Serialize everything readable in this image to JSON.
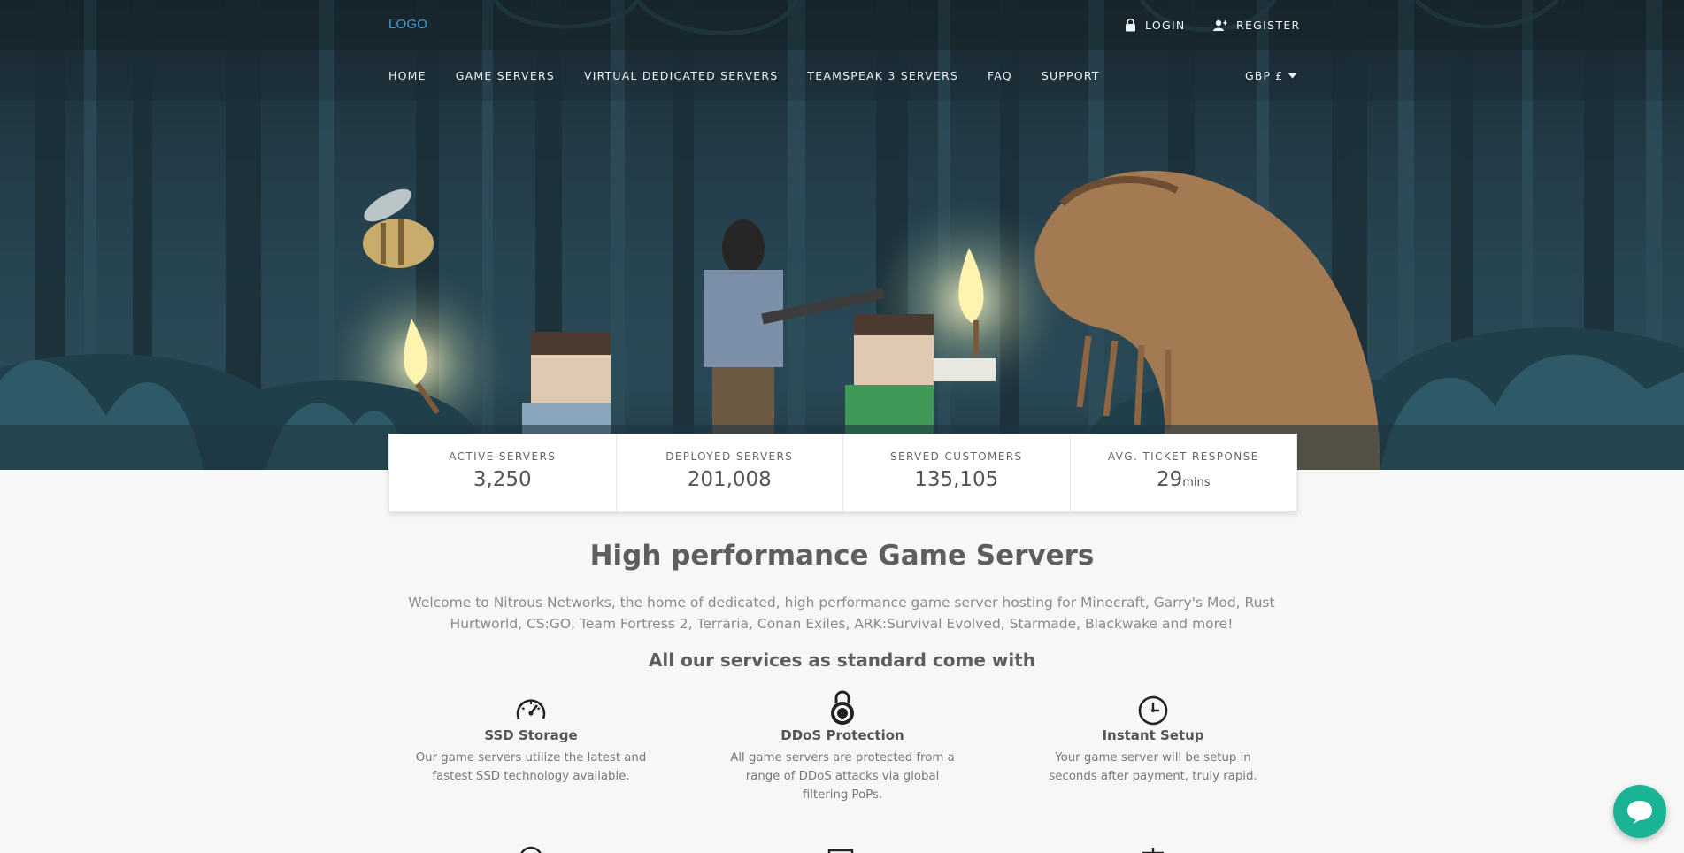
{
  "header": {
    "logo": "LOGO",
    "login": "LOGIN",
    "register": "REGISTER",
    "currency": "GBP £"
  },
  "nav": {
    "items": [
      {
        "label": "HOME"
      },
      {
        "label": "GAME SERVERS"
      },
      {
        "label": "VIRTUAL DEDICATED SERVERS"
      },
      {
        "label": "TEAMSPEAK 3 SERVERS"
      },
      {
        "label": "FAQ"
      },
      {
        "label": "SUPPORT"
      }
    ]
  },
  "stats": [
    {
      "label": "ACTIVE SERVERS",
      "value": "3,250",
      "unit": ""
    },
    {
      "label": "DEPLOYED SERVERS",
      "value": "201,008",
      "unit": ""
    },
    {
      "label": "SERVED CUSTOMERS",
      "value": "135,105",
      "unit": ""
    },
    {
      "label": "AVG. TICKET RESPONSE",
      "value": "29",
      "unit": "mins"
    }
  ],
  "main": {
    "headline": "High performance Game Servers",
    "intro": "Welcome to Nitrous Networks, the home of dedicated, high performance game server hosting for Minecraft, Garry's Mod, Rust Hurtworld, CS:GO, Team Fortress 2, Terraria, Conan Exiles, ARK:Survival Evolved, Starmade, Blackwake and more!",
    "subhead": "All our services as standard come with",
    "features": [
      {
        "icon": "speedometer-icon",
        "title": "SSD Storage",
        "desc": "Our game servers utilize the latest and fastest SSD technology available."
      },
      {
        "icon": "padlock-icon",
        "title": "DDoS Protection",
        "desc": "All game servers are protected from a range of DDoS attacks via global filtering PoPs."
      },
      {
        "icon": "clock-icon",
        "title": "Instant Setup",
        "desc": "Your game server will be setup in seconds after payment, truly rapid."
      }
    ]
  },
  "colors": {
    "accent": "#3f9fd3",
    "chat": "#1ab394",
    "hero_dark": "#1a2a33"
  }
}
